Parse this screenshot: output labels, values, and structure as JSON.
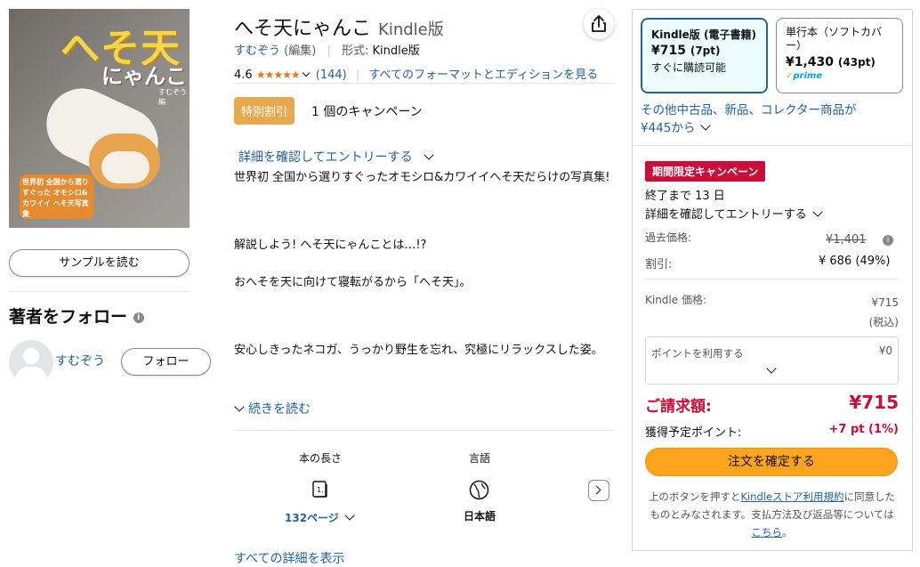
{
  "cover": {
    "title_line1": "へそ天",
    "title_line2": "にゃんこ",
    "author_small": "すむぞう 編",
    "badge": "世界初 全国から選りすぐった オモシロ&カワイイ へそ天写真集"
  },
  "left": {
    "sample_button": "サンプルを読む",
    "follow_heading": "著者をフォロー",
    "author_name": "すむぞう",
    "follow_button": "フォロー"
  },
  "product": {
    "title": "へそ天にゃんこ",
    "format_label": "Kindle版",
    "author_link": "すむぞう",
    "author_role": "(編集)",
    "format_key": "形式:",
    "format_value": "Kindle版",
    "rating": "4.6",
    "stars": "★★★★★",
    "review_count": "(144)",
    "all_formats_link": "すべてのフォーマットとエディションを見る",
    "campaign_tag": "特別割引",
    "campaign_count": "1 個のキャンペーン",
    "entry_link": "詳細を確認してエントリーする",
    "desc_1": "世界初 全国から選りすぐったオモシロ&カワイイへそ天だらけの写真集!",
    "desc_2": "解説しよう! へそ天にゃんことは…!?",
    "desc_3": "おへそを天に向けて寝転がるから「へそ天」。",
    "desc_4": "安心しきったネコガ、うっかり野生を忘れ、究極にリラックスした姿。",
    "read_more": "続きを読む",
    "attr_length_label": "本の長さ",
    "attr_length_value": "132ページ",
    "attr_lang_label": "言語",
    "attr_lang_value": "日本語",
    "all_details": "すべての詳細を表示"
  },
  "buybox": {
    "formats": [
      {
        "name": "Kindle版 (電子書籍)",
        "price": "¥715",
        "pts": "(7pt)",
        "note": "すぐに購読可能"
      },
      {
        "name": "単行本（ソフトカバー）",
        "price": "¥1,430",
        "pts": "(43pt)",
        "note": "prime"
      }
    ],
    "other_sellers": "その他中古品、新品、コレクター商品が",
    "other_sellers_price": "¥445から",
    "limited_tag": "期間限定キャンペーン",
    "ends_in": "終了まで 13 日",
    "entry": "詳細を確認してエントリーする",
    "past_price_label": "過去価格:",
    "past_price_value": "¥1,401",
    "discount_label": "割引:",
    "discount_value": "¥ 686 (49%)",
    "kindle_price_label": "Kindle 価格:",
    "kindle_price_value": "¥715",
    "tax_note": "(税込)",
    "points_use_label": "ポイントを利用する",
    "points_use_value": "¥0",
    "total_label": "ご請求額:",
    "total_value": "¥715",
    "earn_label": "獲得予定ポイント:",
    "earn_value": "+7 pt (1%)",
    "buy_button": "注文を確定する",
    "terms_1": "上のボタンを押すと",
    "terms_link": "Kindleストア利用規約",
    "terms_2": "に同意したものとみなされます。支払方法及び返品等については",
    "terms_link2": "こちら",
    "terms_3": "。"
  },
  "colors": {
    "link": "#2162a1",
    "star": "#de7921",
    "buy": "#ffa41c",
    "red": "#cc0c39",
    "selected_border": "#2162a1"
  }
}
